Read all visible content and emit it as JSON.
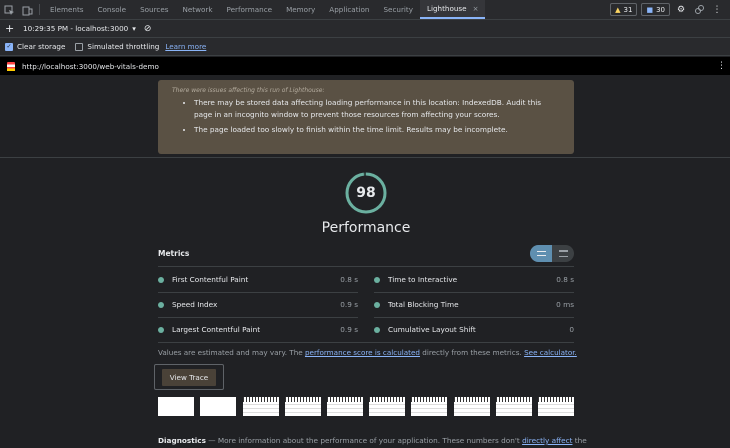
{
  "tabs": [
    "Elements",
    "Console",
    "Sources",
    "Network",
    "Performance",
    "Memory",
    "Application",
    "Security",
    "Lighthouse"
  ],
  "active_tab_close": "×",
  "badges": {
    "warnings": "31",
    "messages": "30"
  },
  "toolbar": {
    "report": "10:29:35 PM - localhost:3000",
    "plus": "+"
  },
  "options": {
    "clear_storage": "Clear storage",
    "simulated_throttling": "Simulated throttling",
    "learn_more": "Learn more"
  },
  "url": "http://localhost:3000/web-vitals-demo",
  "warning": {
    "heading": "There were issues affecting this run of Lighthouse:",
    "items": [
      "There may be stored data affecting loading performance in this location: IndexedDB. Audit this page in an incognito window to prevent those resources from affecting your scores.",
      "The page loaded too slowly to finish within the time limit. Results may be incomplete."
    ]
  },
  "score": {
    "value": "98",
    "fraction": 0.98,
    "color": "#6bb0a0"
  },
  "category_title": "Performance",
  "metrics_label": "Metrics",
  "metrics": [
    {
      "name": "First Contentful Paint",
      "value": "0.8 s"
    },
    {
      "name": "Time to Interactive",
      "value": "0.8 s"
    },
    {
      "name": "Speed Index",
      "value": "0.9 s"
    },
    {
      "name": "Total Blocking Time",
      "value": "0 ms"
    },
    {
      "name": "Largest Contentful Paint",
      "value": "0.9 s"
    },
    {
      "name": "Cumulative Layout Shift",
      "value": "0"
    }
  ],
  "estimate": {
    "prefix": "Values are estimated and may vary. The ",
    "link1": "performance score is calculated",
    "middle": " directly from these metrics. ",
    "link2": "See calculator."
  },
  "view_trace": "View Trace",
  "diagnostics": {
    "title": "Diagnostics",
    "text": " — More information about the performance of your application. These numbers don't ",
    "link": "directly affect",
    "suffix": " the"
  }
}
